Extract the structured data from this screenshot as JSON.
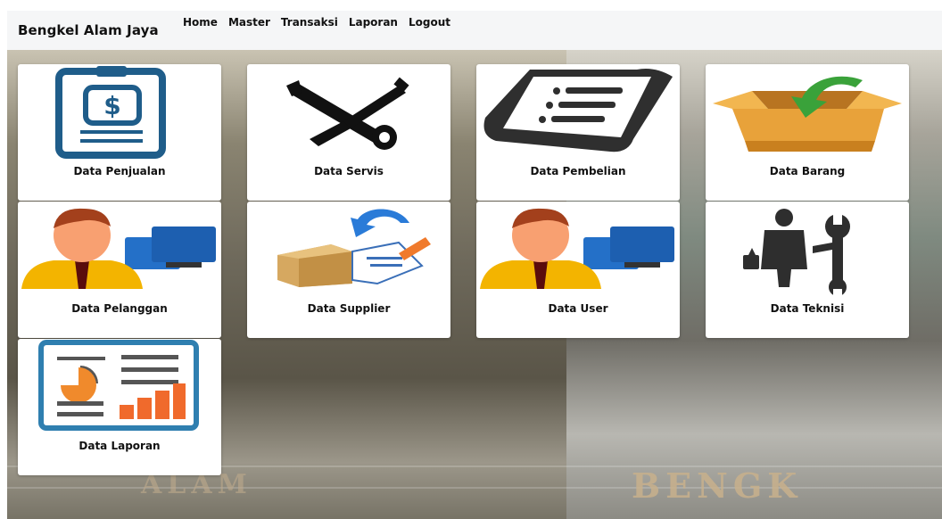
{
  "navbar": {
    "brand": "Bengkel Alam Jaya",
    "links": [
      "Home",
      "Master",
      "Transaksi",
      "Laporan",
      "Logout"
    ]
  },
  "background": {
    "signs": [
      "ALAM",
      "BENGK"
    ]
  },
  "cards": [
    {
      "label": "Data Penjualan",
      "icon": "sales-clipboard-dollar-icon"
    },
    {
      "label": "Data Servis",
      "icon": "wrench-screwdriver-icon"
    },
    {
      "label": "Data Pembelian",
      "icon": "receipt-list-icon"
    },
    {
      "label": "Data Barang",
      "icon": "box-arrow-icon"
    },
    {
      "label": "Data Pelanggan",
      "icon": "user-computer-icon"
    },
    {
      "label": "Data Supplier",
      "icon": "box-document-arrow-icon"
    },
    {
      "label": "Data User",
      "icon": "user-computer-icon"
    },
    {
      "label": "Data Teknisi",
      "icon": "technician-wrench-icon"
    },
    {
      "label": "Data Laporan",
      "icon": "report-chart-icon"
    }
  ],
  "colors": {
    "navbar_bg": "#f5f6f7",
    "card_bg": "#ffffff",
    "icon_blue": "#1f5d8a",
    "icon_orange": "#f08a2c"
  }
}
